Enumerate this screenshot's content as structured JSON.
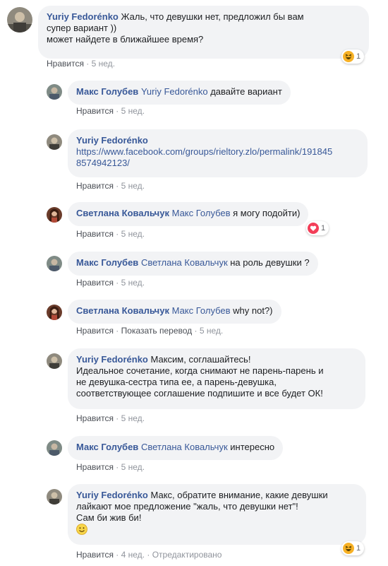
{
  "comments": [
    {
      "author": "Yuriy Fedorénko",
      "text_line1": " Жаль, что девушки нет, предложил бы вам",
      "text_line2": "супер вариант ))",
      "text_line3": "может найдете в ближайшее время?",
      "like_label": "Нравится",
      "time": "5 нед.",
      "reaction": {
        "icon": "haha-icon",
        "count": "1"
      }
    },
    {
      "author": "Макс Голубев",
      "mention": "Yuriy Fedorénko",
      "text": " давайте вариант",
      "like_label": "Нравится",
      "time": "5 нед."
    },
    {
      "author": "Yuriy Fedorénko",
      "link_line1": "https://www.facebook.com/groups/rieltory.zlo/permalink/191845",
      "link_line2": "8574942123/",
      "like_label": "Нравится",
      "time": "5 нед."
    },
    {
      "author": "Светлана Ковальчук",
      "mention": "Макс Голубев",
      "text": " я могу подойти)",
      "like_label": "Нравится",
      "time": "5 нед.",
      "reaction": {
        "icon": "love-icon",
        "count": "1"
      }
    },
    {
      "author": "Макс Голубев",
      "mention": "Светлана Ковальчук",
      "text": " на роль девушки ?",
      "like_label": "Нравится",
      "time": "5 нед."
    },
    {
      "author": "Светлана Ковальчук",
      "mention": "Макс Голубев",
      "text": " why not?)",
      "like_label": "Нравится",
      "translate_label": "Показать перевод",
      "time": "5 нед."
    },
    {
      "author": "Yuriy Fedorénko",
      "text_line1": " Максим, соглашайтесь!",
      "text_line2": "Идеальное сочетание, когда снимают не парень-парень и",
      "text_line3": "не девушка-сестра типа ее, а парень-девушка,",
      "text_line4": "соответствующее соглашение подпишите и все будет ОК!",
      "like_label": "Нравится",
      "time": "5 нед."
    },
    {
      "author": "Макс Голубев",
      "mention": "Светлана Ковальчук",
      "text": " интересно",
      "like_label": "Нравится",
      "time": "5 нед."
    },
    {
      "author": "Yuriy Fedorénko",
      "text_line1": " Макс, обратите внимание, какие девушки",
      "text_line2": "лайкают мое предложение \"жаль, что девушки нет\"!",
      "text_line3": "Сам би жив би!",
      "emoji": "smile-emoji",
      "like_label": "Нравится",
      "time": "4 нед.",
      "edited_label": "Отредактировано",
      "reaction": {
        "icon": "haha-icon",
        "count": "1"
      }
    }
  ],
  "separator": "·",
  "colors": {
    "link": "#385898",
    "bubble": "#f2f3f5",
    "meta": "#90949c",
    "love": "#f33e58",
    "haha": "#f7b125"
  }
}
